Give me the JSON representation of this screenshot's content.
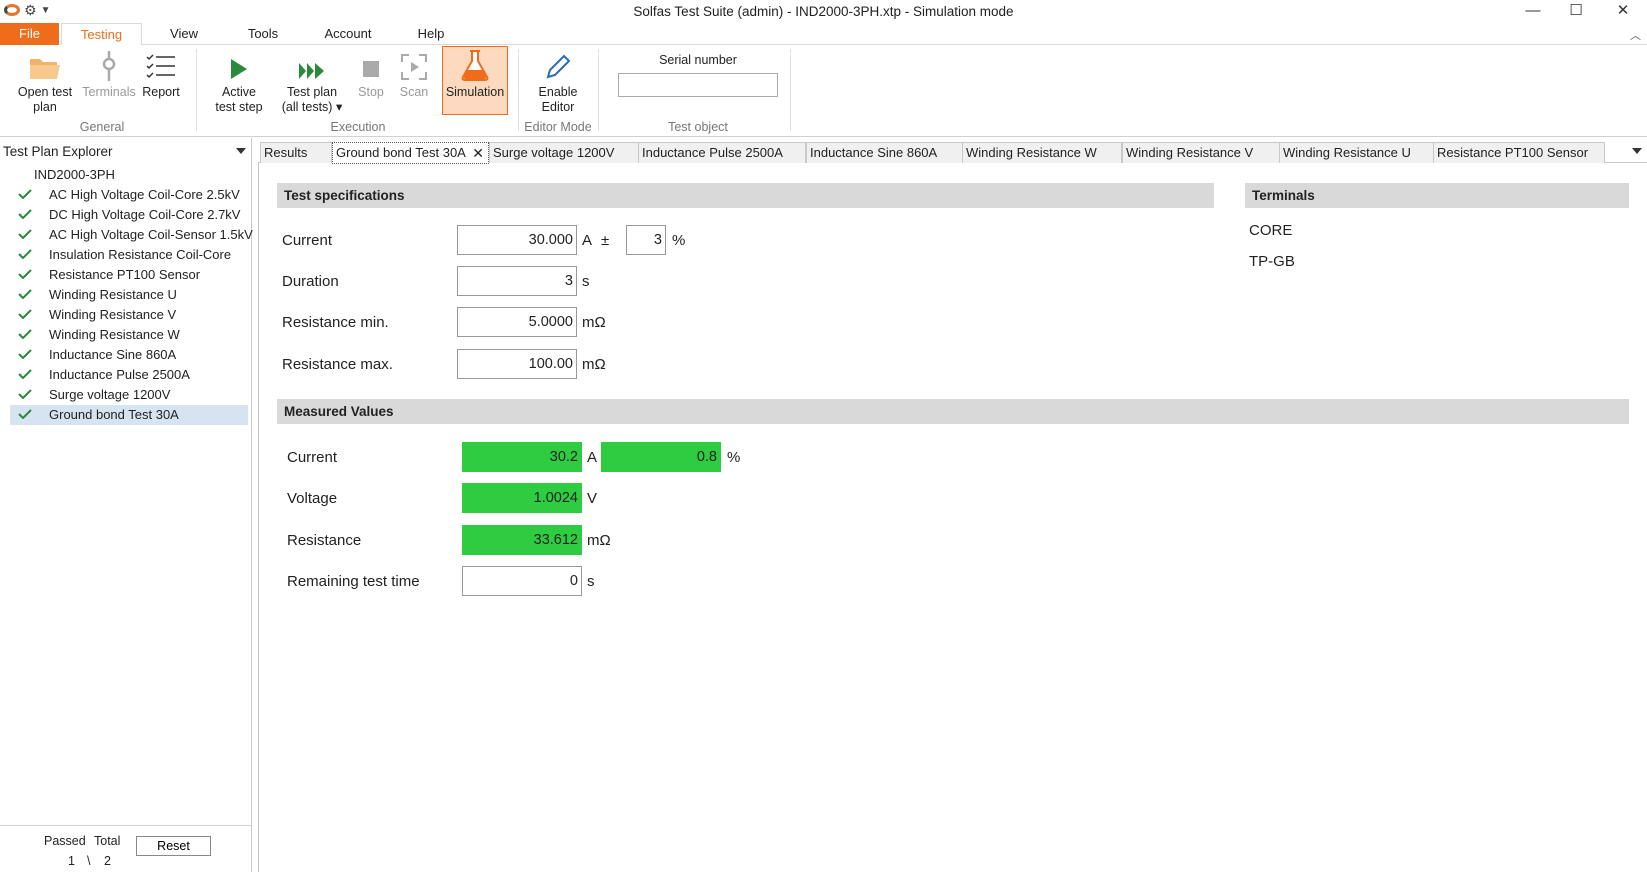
{
  "window": {
    "title": "Solfas Test Suite (admin)  - IND2000-3PH.xtp - Simulation mode",
    "minimize": "—",
    "maximize": "☐",
    "close": "✕"
  },
  "menu": {
    "file": "File",
    "testing": "Testing",
    "view": "View",
    "tools": "Tools",
    "account": "Account",
    "help": "Help"
  },
  "ribbon": {
    "open_test_plan": [
      "Open test",
      "plan"
    ],
    "terminals": "Terminals",
    "report": "Report",
    "general_group": "General",
    "active_test_step": [
      "Active",
      "test step"
    ],
    "test_plan_all": [
      "Test plan",
      "(all tests) ▾"
    ],
    "stop": "Stop",
    "scan": "Scan",
    "simulation": "Simulation",
    "execution_group": "Execution",
    "enable_editor": [
      "Enable",
      "Editor"
    ],
    "editor_mode_group": "Editor Mode",
    "serial_number_label": "Serial number",
    "serial_number_value": "",
    "test_object_group": "Test object"
  },
  "explorer": {
    "header": "Test Plan Explorer",
    "root": "IND2000-3PH",
    "items": [
      {
        "label": "AC High Voltage Coil-Core 2.5kV",
        "passed": true
      },
      {
        "label": "DC High Voltage Coil-Core 2.7kV",
        "passed": true
      },
      {
        "label": "AC High Voltage Coil-Sensor 1.5kV",
        "passed": true
      },
      {
        "label": "Insulation Resistance Coil-Core",
        "passed": true
      },
      {
        "label": "Resistance PT100 Sensor",
        "passed": true
      },
      {
        "label": "Winding Resistance U",
        "passed": true
      },
      {
        "label": "Winding Resistance  V",
        "passed": true
      },
      {
        "label": "Winding Resistance  W",
        "passed": true
      },
      {
        "label": "Inductance Sine 860A",
        "passed": true
      },
      {
        "label": "Inductance Pulse 2500A",
        "passed": true
      },
      {
        "label": "Surge voltage 1200V",
        "passed": true
      },
      {
        "label": "Ground bond Test 30A",
        "passed": true,
        "selected": true
      }
    ],
    "passed_label": "Passed",
    "total_label": "Total",
    "passed_value": "1",
    "separator": "\\",
    "total_value": "2",
    "reset": "Reset"
  },
  "tabs": [
    {
      "label": "Results"
    },
    {
      "label": "Ground bond Test 30A",
      "active": true
    },
    {
      "label": "Surge voltage 1200V"
    },
    {
      "label": "Inductance Pulse 2500A"
    },
    {
      "label": "Inductance Sine 860A"
    },
    {
      "label": "Winding Resistance  W"
    },
    {
      "label": "Winding Resistance  V"
    },
    {
      "label": "Winding Resistance U"
    },
    {
      "label": "Resistance PT100 Sensor"
    }
  ],
  "spec": {
    "header": "Test specifications",
    "current_label": "Current",
    "current_value": "30.000",
    "current_unit": "A",
    "plusminus": "±",
    "tolerance_value": "3",
    "tolerance_unit": "%",
    "duration_label": "Duration",
    "duration_value": "3",
    "duration_unit": "s",
    "rmin_label": "Resistance min.",
    "rmin_value": "5.0000",
    "rmin_unit": "mΩ",
    "rmax_label": "Resistance max.",
    "rmax_value": "100.00",
    "rmax_unit": "mΩ"
  },
  "terminals": {
    "header": "Terminals",
    "items": [
      "CORE",
      "TP-GB"
    ]
  },
  "measured": {
    "header": "Measured Values",
    "current_label": "Current",
    "current_value": "30.2",
    "current_unit": "A",
    "deviation_value": "0.8",
    "deviation_unit": "%",
    "voltage_label": "Voltage",
    "voltage_value": "1.0024",
    "voltage_unit": "V",
    "resistance_label": "Resistance",
    "resistance_value": "33.612",
    "resistance_unit": "mΩ",
    "remaining_label": "Remaining test time",
    "remaining_value": "0",
    "remaining_unit": "s"
  },
  "colors": {
    "accent": "#ef6c1a",
    "pass_green": "#2ecc40",
    "section_grey": "#d9d9d9"
  }
}
